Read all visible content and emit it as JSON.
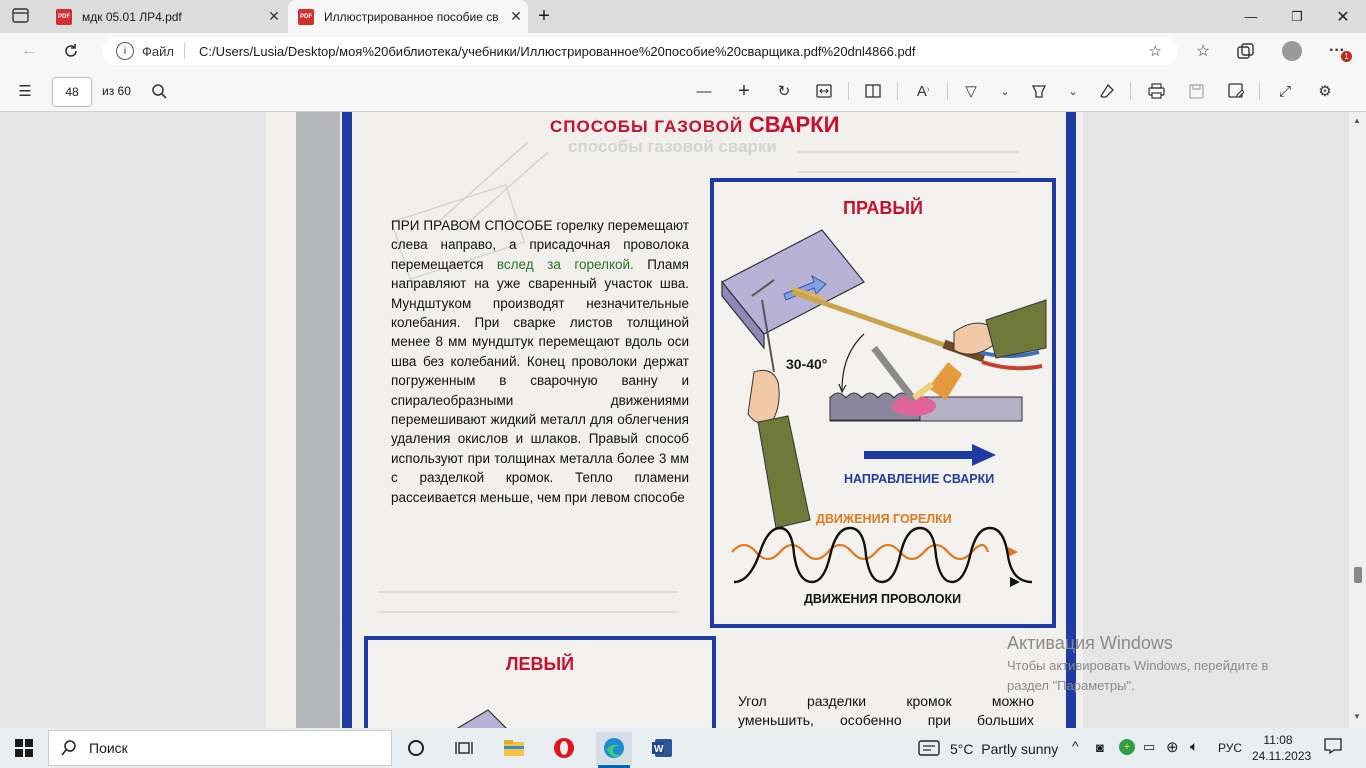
{
  "browser": {
    "tabs": [
      {
        "label": "мдк 05.01 ЛР4.pdf",
        "active": false
      },
      {
        "label": "Иллюстрированное пособие св",
        "active": true
      }
    ],
    "new_tab": "+",
    "address_prefix": "Файл",
    "url": "C:/Users/Lusia/Desktop/моя%20библиотека/учебники/Иллюстрированное%20пособие%20сварщика.pdf%20dnl4866.pdf",
    "notification_badge": "1"
  },
  "pdf_toolbar": {
    "page_number": "48",
    "page_total": "из 60"
  },
  "page": {
    "header": "СПОСОБЫ ГАЗОВОЙ СВАРКИ",
    "header_a": "СПОСОБЫ ГАЗОВОЙ ",
    "header_b": "СВАРКИ",
    "paragraph_part1": "ПРИ ПРАВОМ СПОСОБЕ горелку перемещают слева направо, а приса­дочная проволока перемещается ",
    "paragraph_highlight": "вслед за горелкой.",
    "paragraph_part2": " Пламя направляют на уже сваренный участок шва. Мундштуком производят нез­начительные колебания. При сварке листов толщиной менее 8 мм мундштук перемещают вдоль оси шва без колебаний. Конец проволоки держат погруженным в сварочную ванну и спиралеобразными дви­жениями перемешивают жидкий металл для облегчения удаления окислов и шлаков. Правый способ используют при толщинах металла более 3 мм с разделкой кромок. Тепло пламени рассеивается меньше, чем при левом способе",
    "right_title": "ПРАВЫЙ",
    "angle_label": "30-40°",
    "direction_label": "НАПРАВЛЕНИЕ СВАРКИ",
    "torch_motion_label": "ДВИЖЕНИЯ ГОРЕЛКИ",
    "wire_motion_label": "ДВИЖЕНИЯ ПРОВОЛОКИ",
    "left_title": "ЛЕВЫЙ",
    "left_text_line1": "Угол разделки кромок можно",
    "left_text_line2": "уменьшить, особенно при больших"
  },
  "watermark": {
    "title": "Активация Windows",
    "line1": "Чтобы активировать Windows, перейдите в",
    "line2": "раздел \"Параметры\"."
  },
  "taskbar": {
    "search_label": "Поиск",
    "weather": "5°C  Partly sunny",
    "language": "РУС",
    "time": "11:08",
    "date": "24.11.2023"
  },
  "colors": {
    "accent_red": "#c8102e",
    "frame_blue": "#1f3ba4",
    "torch_orange": "#e07a1f"
  }
}
